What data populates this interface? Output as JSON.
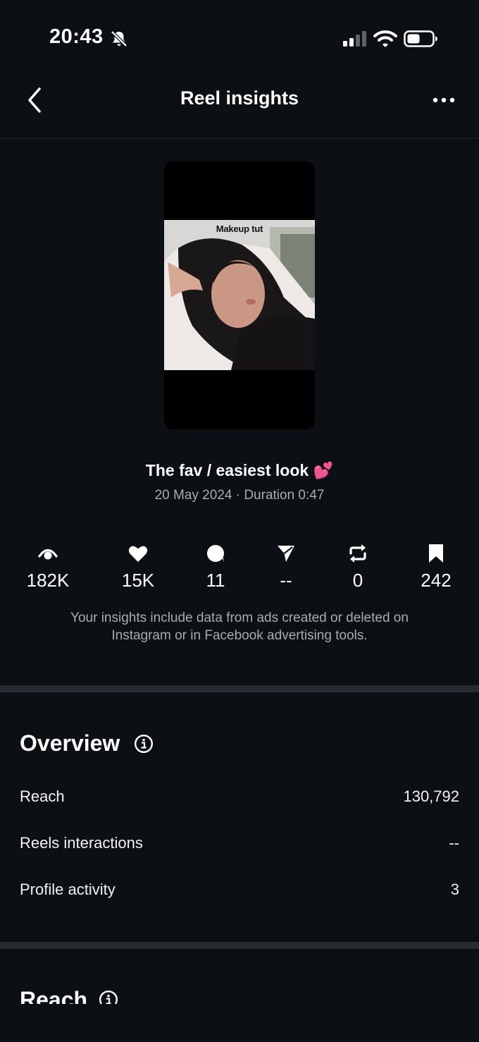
{
  "status_bar": {
    "time": "20:43",
    "icons": [
      "bell-muted-icon",
      "signal-icon",
      "wifi-icon",
      "battery-icon"
    ]
  },
  "nav": {
    "title": "Reel insights",
    "back_icon": "chevron-left-icon",
    "more_icon": "more-horizontal-icon"
  },
  "reel": {
    "thumbnail_caption": "Makeup tut",
    "title": "The fav / easiest look 💕",
    "meta": "20 May 2024 · Duration 0:47"
  },
  "stats": [
    {
      "icon": "eye-icon",
      "value": "182K"
    },
    {
      "icon": "heart-icon",
      "value": "15K"
    },
    {
      "icon": "comment-icon",
      "value": "11"
    },
    {
      "icon": "share-icon",
      "value": "--"
    },
    {
      "icon": "repost-icon",
      "value": "0"
    },
    {
      "icon": "bookmark-icon",
      "value": "242"
    }
  ],
  "disclaimer_line1": "Your insights include data from ads created or deleted on",
  "disclaimer_line2": "Instagram or in Facebook advertising tools.",
  "overview": {
    "title": "Overview",
    "rows": [
      {
        "label": "Reach",
        "value": "130,792"
      },
      {
        "label": "Reels interactions",
        "value": "--"
      },
      {
        "label": "Profile activity",
        "value": "3"
      }
    ]
  },
  "reach": {
    "title": "Reach"
  },
  "colors": {
    "background": "#0c1014",
    "divider": "#262c32",
    "muted_text": "#a8acb2"
  }
}
